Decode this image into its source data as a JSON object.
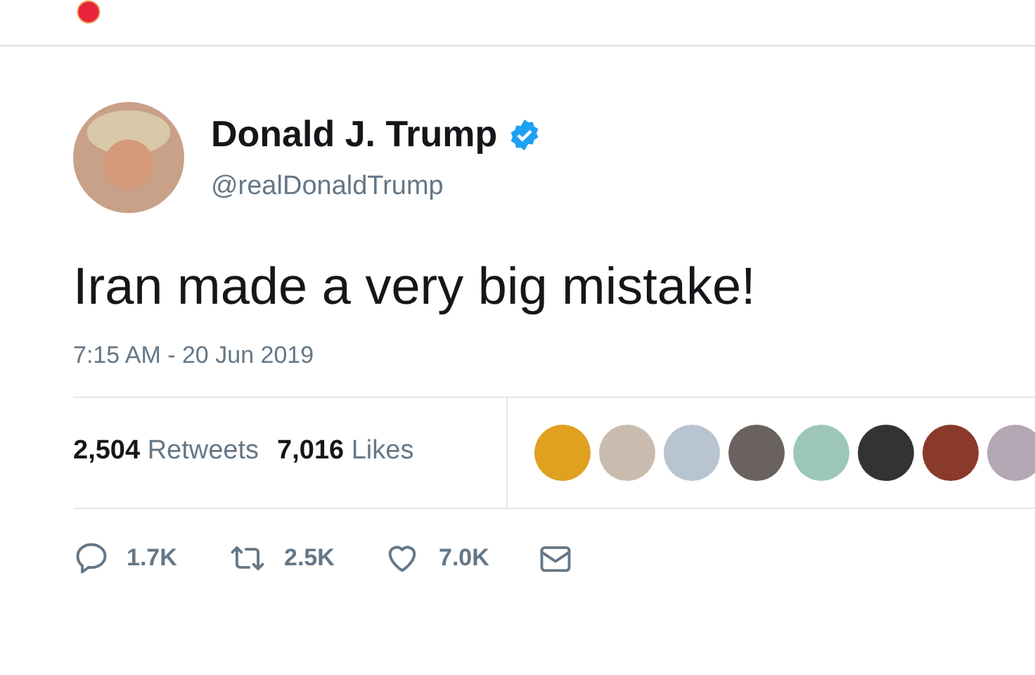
{
  "tweet": {
    "name": "Donald J. Trump",
    "verified": true,
    "handle": "@realDonaldTrump",
    "text": "Iran made a very big mistake!",
    "timestamp": "7:15 AM - 20 Jun 2019",
    "stats": [
      {
        "count": "2,504",
        "label": "Retweets"
      },
      {
        "count": "7,016",
        "label": "Likes"
      }
    ],
    "likers": [
      {
        "color": "#e0a020"
      },
      {
        "color": "#c9bcae"
      },
      {
        "color": "#b8c4d0"
      },
      {
        "color": "#6a625e"
      },
      {
        "color": "#9cc7b8"
      },
      {
        "color": "#333333"
      },
      {
        "color": "#8a3a2a"
      },
      {
        "color": "#b4a8b4"
      }
    ],
    "actions": [
      {
        "kind": "reply",
        "count": "1.7K"
      },
      {
        "kind": "retweet",
        "count": "2.5K"
      },
      {
        "kind": "like",
        "count": "7.0K"
      },
      {
        "kind": "message"
      }
    ]
  }
}
